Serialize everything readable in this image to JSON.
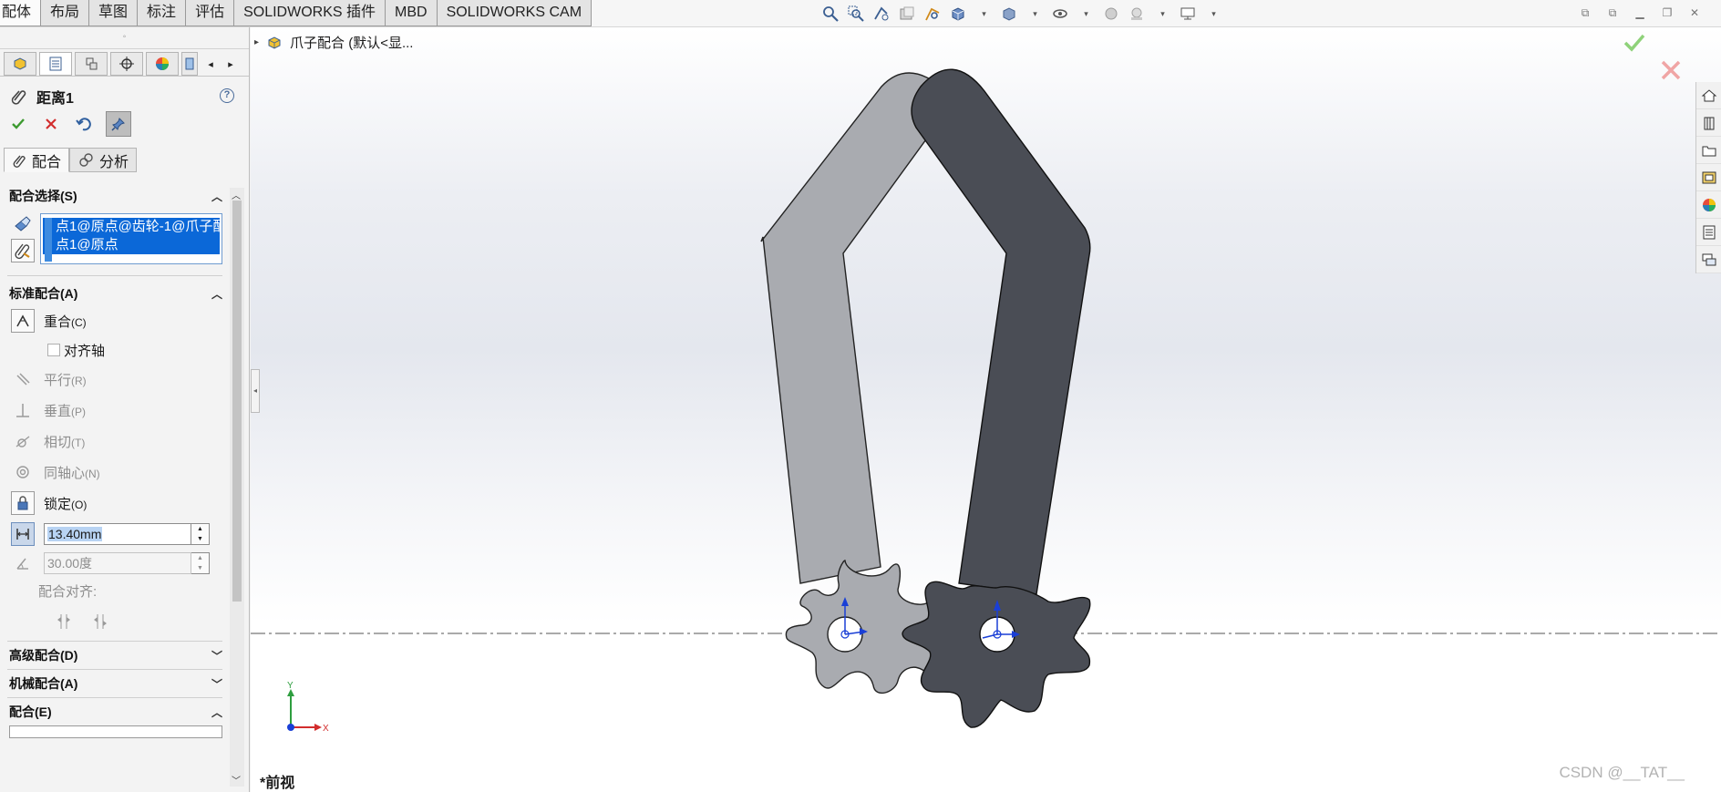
{
  "command_tabs": [
    "配体",
    "布局",
    "草图",
    "标注",
    "评估",
    "SOLIDWORKS 插件",
    "MBD",
    "SOLIDWORKS CAM"
  ],
  "active_tab_index": 0,
  "view_toolbar": {
    "icons": [
      "zoom-to-fit-icon",
      "zoom-area-icon",
      "previous-view-icon",
      "section-view-icon",
      "dynamic-annotation-icon",
      "view-orientation-icon",
      "display-style-icon",
      "hide-show-icon",
      "edit-appearance-icon",
      "apply-scene-icon",
      "view-settings-icon"
    ]
  },
  "property_manager": {
    "title": "距离1",
    "help": "?",
    "tabs": [
      {
        "label": "配合",
        "icon": "mate-icon"
      },
      {
        "label": "分析",
        "icon": "analysis-icon"
      }
    ],
    "sections": {
      "mate_selections": {
        "header": "配合选择(S)",
        "items": [
          "点1@原点@齿轮-1@爪子配",
          "点1@原点"
        ]
      },
      "standard_mates": {
        "header": "标准配合(A)",
        "coincident": {
          "label": "重合",
          "hotkey": "(C)"
        },
        "align_axis": {
          "label": "对齐轴"
        },
        "parallel": {
          "label": "平行",
          "hotkey": "(R)"
        },
        "perpendicular": {
          "label": "垂直",
          "hotkey": "(P)"
        },
        "tangent": {
          "label": "相切",
          "hotkey": "(T)"
        },
        "concentric": {
          "label": "同轴心",
          "hotkey": "(N)"
        },
        "lock": {
          "label": "锁定",
          "hotkey": "(O)"
        },
        "distance": {
          "value": "13.40mm"
        },
        "angle": {
          "value": "30.00度"
        },
        "mate_alignment": {
          "label": "配合对齐:"
        }
      },
      "advanced_mates": {
        "header": "高级配合(D)"
      },
      "mechanical_mates": {
        "header": "机械配合(A)"
      },
      "mates": {
        "header": "配合(E)"
      }
    }
  },
  "graphics": {
    "tree_label": "爪子配合 (默认<显...",
    "view_name": "*前视",
    "watermark": "CSDN @__TAT__",
    "triad": {
      "y": "Y",
      "x": "X"
    }
  },
  "colors": {
    "light_part": "#a9abb0",
    "dark_part": "#4a4d55",
    "accent_blue": "#0b68d8",
    "ok_green": "#5bb83e",
    "cancel_red": "#d9343a"
  }
}
